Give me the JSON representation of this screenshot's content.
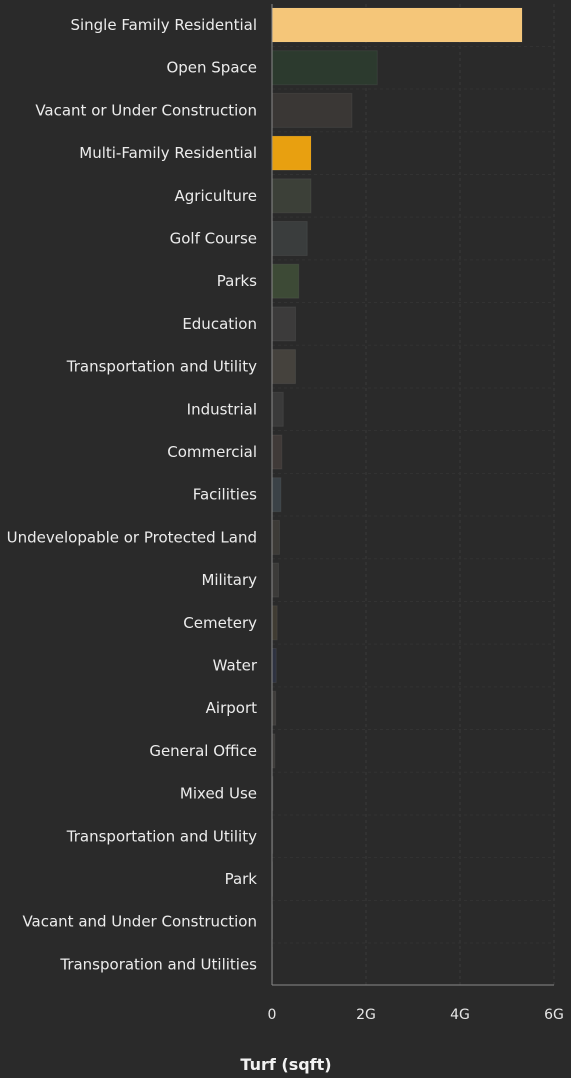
{
  "chart_data": {
    "type": "bar",
    "orientation": "horizontal",
    "xlabel": "Turf (sqft)",
    "xlim": [
      0,
      6000000000
    ],
    "xticks": [
      {
        "value": 0,
        "label": "0"
      },
      {
        "value": 2000000000,
        "label": "2G"
      },
      {
        "value": 4000000000,
        "label": "4G"
      },
      {
        "value": 6000000000,
        "label": "6G"
      }
    ],
    "grid": true,
    "categories": [
      "Single Family Residential",
      "Open Space",
      "Vacant or Under Construction",
      "Multi-Family Residential",
      "Agriculture",
      "Golf Course",
      "Parks",
      "Education",
      "Transportation and Utility",
      "Industrial",
      "Commercial",
      "Facilities",
      "Undevelopable or Protected Land",
      "Military",
      "Cemetery",
      "Water",
      "Airport",
      "General Office",
      "Mixed Use",
      "Transportation and Utility",
      "Park",
      "Vacant and Under Construction",
      "Transporation and Utilities"
    ],
    "values": [
      5320000000,
      2240000000,
      1700000000,
      830000000,
      830000000,
      750000000,
      570000000,
      500000000,
      500000000,
      240000000,
      210000000,
      190000000,
      160000000,
      140000000,
      110000000,
      90000000,
      80000000,
      60000000,
      20000000,
      15000000,
      12000000,
      10000000,
      8000000
    ],
    "colors": [
      "#f5c679",
      "#2c3a2e",
      "#3a3735",
      "#e8a010",
      "#3c4038",
      "#3a3d3d",
      "#3d4a36",
      "#3c3b3b",
      "#45423d",
      "#3a3a3a",
      "#403a38",
      "#3b4247",
      "#3d3b37",
      "#3c3b39",
      "#403c33",
      "#2e3240",
      "#3f3d3b",
      "#3e3c3a",
      "#333333",
      "#333333",
      "#333333",
      "#333333",
      "#333333"
    ]
  }
}
